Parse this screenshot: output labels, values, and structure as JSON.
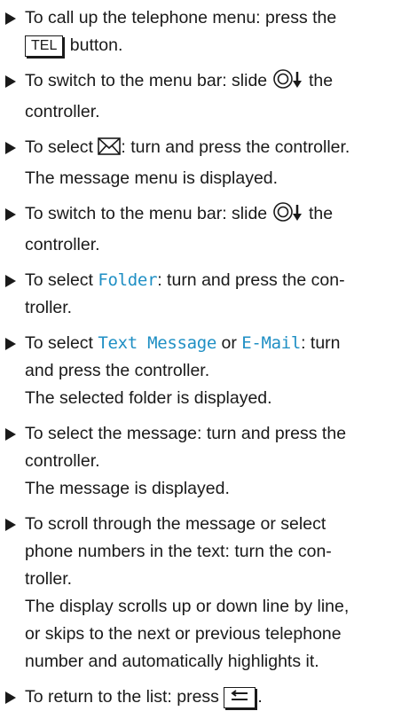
{
  "steps": [
    {
      "pre": "To call up the telephone menu: press the",
      "button": "TEL",
      "post": "button."
    },
    {
      "pre": "To switch to the menu bar: slide",
      "post": "the controller."
    },
    {
      "pre": "To select",
      "post": ": turn and press the controller.",
      "result": "The message menu is displayed."
    },
    {
      "pre": "To switch to the menu bar: slide",
      "post": "the controller."
    },
    {
      "pre": "To select",
      "mono": "Folder",
      "post": ": turn and press the con-",
      "post2": "troller."
    },
    {
      "pre": "To select",
      "mono1": "Text Message",
      "mid": "or",
      "mono2": "E-Mail",
      "post": ": turn",
      "post2": "and press the controller.",
      "result": "The selected folder is displayed."
    },
    {
      "line1": "To select the message: turn and press the",
      "line2": "controller.",
      "result": "The message is displayed."
    },
    {
      "line1": "To scroll through the message or select",
      "line2": "phone numbers in the text: turn the con-",
      "line3": "troller.",
      "result1": "The display scrolls up or down line by line,",
      "result2": "or skips to the next or previous telephone",
      "result3": "number and automatically highlights it."
    },
    {
      "pre": "To return to the list: press",
      "post": "."
    }
  ],
  "icons": [
    "controller-slide-down-icon",
    "envelope-icon",
    "back-button-icon"
  ]
}
